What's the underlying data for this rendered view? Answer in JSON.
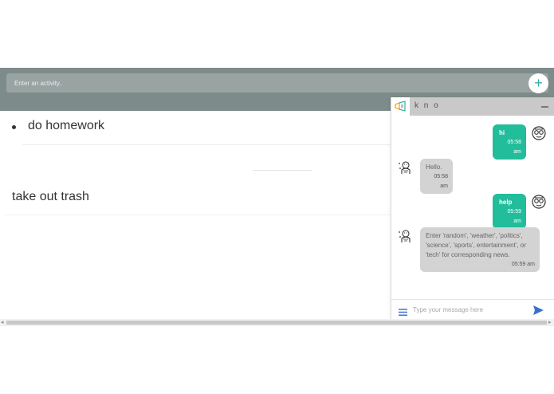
{
  "header": {
    "input_placeholder": "Enter an activity..",
    "add_label": "+"
  },
  "todos": [
    {
      "label": "do homework"
    },
    {
      "label": "take out trash"
    }
  ],
  "chat": {
    "title": "k n o",
    "messages": [
      {
        "from": "user",
        "text": "hi",
        "time": "05:58 am"
      },
      {
        "from": "bot",
        "text": "Hello.",
        "time": "05:58 am"
      },
      {
        "from": "user",
        "text": "help",
        "time": "05:59 am"
      },
      {
        "from": "bot",
        "text": "Enter 'random', 'weather', 'politics', 'science', 'sports', entertainment', or 'tech' for corresponding news.",
        "time": "05:59 am"
      }
    ],
    "input_placeholder": "Type your message here"
  },
  "colors": {
    "header_bg": "#7d8b8a",
    "accent": "#22bd9b",
    "bot_bubble": "#d3d3d3"
  },
  "icons": [
    "plus-icon",
    "kno-logo-icon",
    "minimize-icon",
    "user-avatar-icon",
    "bot-avatar-icon",
    "menu-icon",
    "send-icon"
  ]
}
